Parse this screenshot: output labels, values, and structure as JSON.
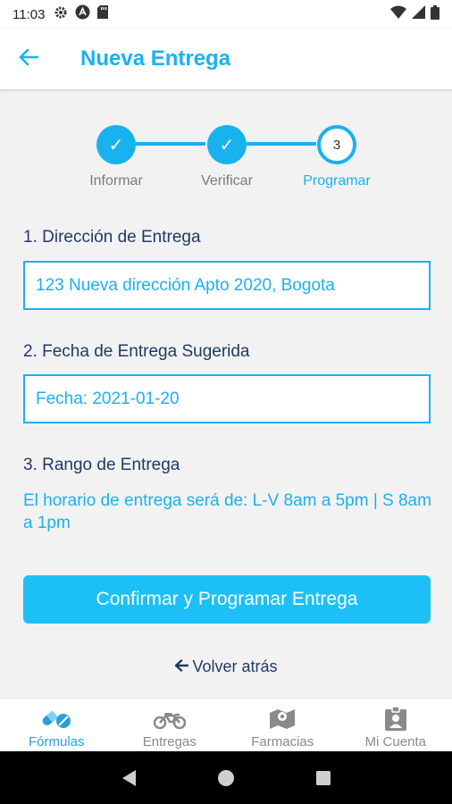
{
  "status_bar": {
    "time": "11:03"
  },
  "app_bar": {
    "title": "Nueva Entrega"
  },
  "stepper": {
    "steps": [
      {
        "label": "Informar",
        "state": "done",
        "mark": "✓"
      },
      {
        "label": "Verificar",
        "state": "done",
        "mark": "✓"
      },
      {
        "label": "Programar",
        "state": "current",
        "mark": "3"
      }
    ]
  },
  "form": {
    "address_label": "1. Dirección de Entrega",
    "address_value": "123 Nueva dirección Apto 2020, Bogota",
    "date_label": "2. Fecha de Entrega Sugerida",
    "date_value": "Fecha: 2021-01-20",
    "range_label": "3. Rango de Entrega",
    "range_text": "El horario de entrega será de: L-V 8am a 5pm | S 8am a 1pm"
  },
  "actions": {
    "confirm_label": "Confirmar y Programar Entrega",
    "back_label": "Volver atrás"
  },
  "bottom_nav": {
    "items": [
      {
        "label": "Fórmulas",
        "icon": "pills-icon"
      },
      {
        "label": "Entregas",
        "icon": "motorcycle-icon"
      },
      {
        "label": "Farmacias",
        "icon": "map-icon"
      },
      {
        "label": "Mi Cuenta",
        "icon": "id-badge-icon"
      }
    ]
  },
  "colors": {
    "accent": "#1ab1ef",
    "button": "#1cc0f7",
    "heading": "#1f3a68",
    "nav_active": "#2a9fd8",
    "nav_inactive": "#8a8a8a",
    "content_bg": "#f2f2f2"
  }
}
